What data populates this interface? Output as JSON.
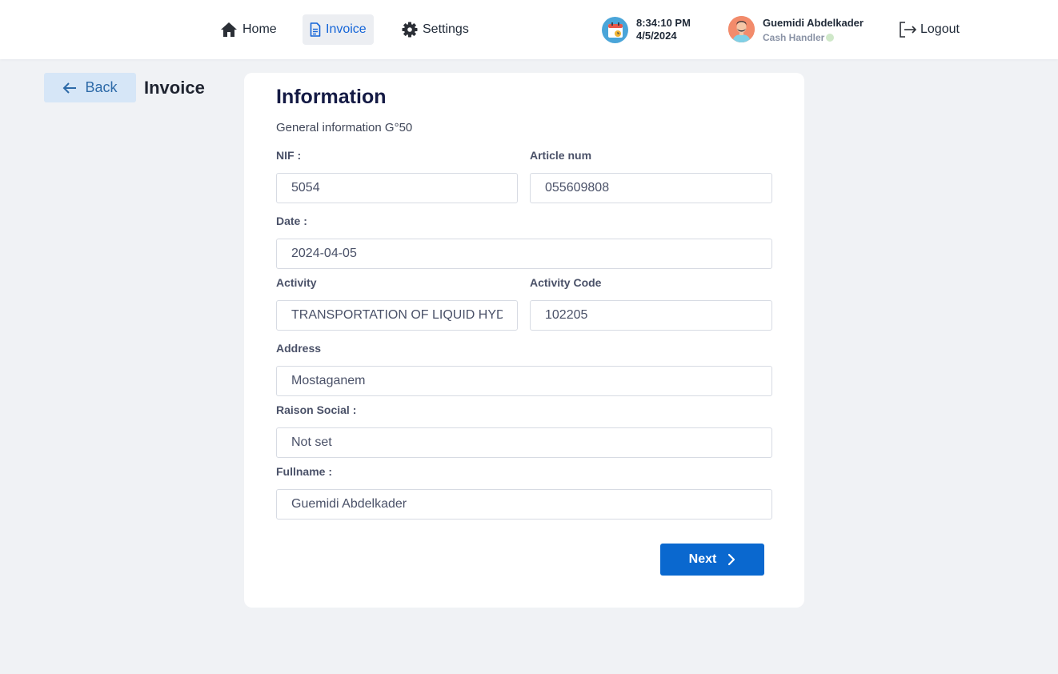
{
  "nav": {
    "home": "Home",
    "invoice": "Invoice",
    "settings": "Settings",
    "active": "invoice"
  },
  "clock": {
    "time": "8:34:10 PM",
    "date": "4/5/2024"
  },
  "user": {
    "name": "Guemidi Abdelkader",
    "role": "Cash Handler",
    "status_color": "#cfe8c9"
  },
  "logout": "Logout",
  "header": {
    "back_label": "Back",
    "title": "Invoice"
  },
  "form": {
    "title": "Information",
    "subtitle": "General information G°50",
    "nif": {
      "label": "NIF :",
      "value": "5054"
    },
    "article_num": {
      "label": "Article num",
      "value": "055609808"
    },
    "date": {
      "label": "Date :",
      "value": "2024-04-05"
    },
    "activity": {
      "label": "Activity",
      "value": "TRANSPORTATION OF LIQUID HYDROCARBONS"
    },
    "activity_code": {
      "label": "Activity Code",
      "value": "102205"
    },
    "address": {
      "label": "Address",
      "value": "Mostaganem"
    },
    "raison_social": {
      "label": "Raison Social :",
      "value": "Not set"
    },
    "fullname": {
      "label": "Fullname :",
      "value": "Guemidi Abdelkader"
    },
    "next_label": "Next"
  },
  "colors": {
    "accent": "#0a68cf",
    "nav_active": "#1565d8",
    "back_bg": "#d6e6f7",
    "title": "#141a44"
  },
  "icons": [
    "home-icon",
    "document-icon",
    "gear-icon",
    "calendar-icon",
    "avatar",
    "logout-icon",
    "arrow-left-icon",
    "chevron-right-icon"
  ]
}
